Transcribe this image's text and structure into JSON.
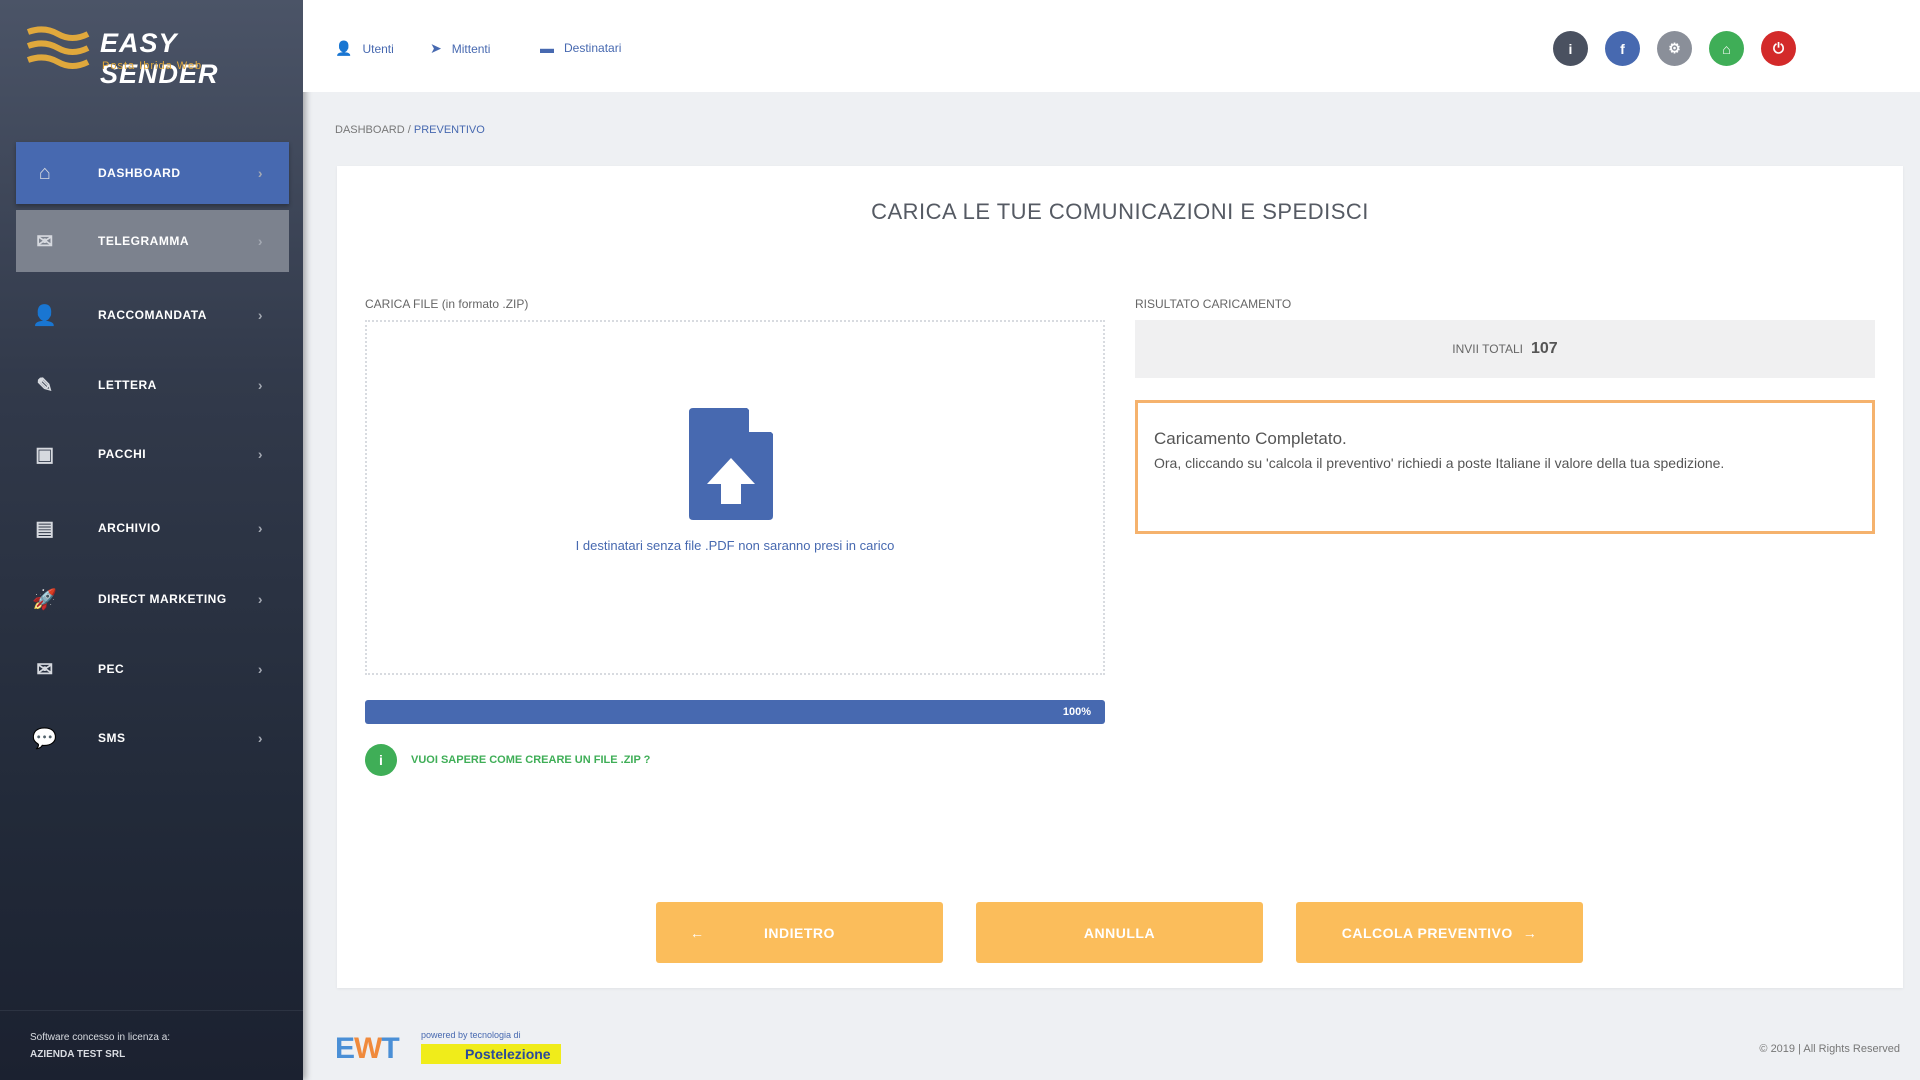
{
  "brand": {
    "name": "EASY SENDER",
    "tagline": "Posta Ibrida Web"
  },
  "sidebar": {
    "items": [
      {
        "label": "DASHBOARD",
        "icon": "home-icon",
        "state": "active"
      },
      {
        "label": "TELEGRAMMA",
        "icon": "telegram-icon",
        "state": "hover"
      },
      {
        "label": "RACCOMANDATA",
        "icon": "user-icon",
        "state": ""
      },
      {
        "label": "LETTERA",
        "icon": "letter-icon",
        "state": ""
      },
      {
        "label": "PACCHI",
        "icon": "package-icon",
        "state": ""
      },
      {
        "label": "ARCHIVIO",
        "icon": "archive-icon",
        "state": ""
      },
      {
        "label": "DIRECT MARKETING",
        "icon": "rocket-icon",
        "state": ""
      },
      {
        "label": "PEC",
        "icon": "pec-icon",
        "state": ""
      },
      {
        "label": "SMS",
        "icon": "sms-icon",
        "state": ""
      }
    ],
    "footer": {
      "line1": "Software concesso in licenza a:",
      "line2": "AZIENDA TEST SRL"
    }
  },
  "header": {
    "nav": [
      {
        "label": "Utenti",
        "icon": "user-icon"
      },
      {
        "label": "Mittenti",
        "icon": "send-icon"
      },
      {
        "label": "Destinatari",
        "icon": "address-card-icon"
      }
    ],
    "circles": [
      {
        "icon": "info-icon",
        "color": "#4a5160",
        "glyph": "i"
      },
      {
        "icon": "facebook-icon",
        "color": "#4769b0",
        "glyph": "f"
      },
      {
        "icon": "settings-icon",
        "color": "#8a8f99",
        "glyph": "⚙"
      },
      {
        "icon": "home-icon",
        "color": "#3fae57",
        "glyph": "⌂"
      },
      {
        "icon": "power-icon",
        "color": "#d32a2a",
        "glyph": "⏻"
      }
    ]
  },
  "breadcrumb": {
    "root": "DASHBOARD",
    "sep": " / ",
    "current": "PREVENTIVO"
  },
  "main": {
    "title": "CARICA LE TUE COMUNICAZIONI E SPEDISCI",
    "upload_label": "CARICA FILE (in formato .ZIP)",
    "drop_text": "I destinatari senza file .PDF non saranno presi in carico",
    "progress": 100,
    "progress_label": "100%",
    "help_text": "VUOI SAPERE COME CREARE UN FILE .ZIP ?",
    "result_label": "RISULTATO CARICAMENTO",
    "total_label": "INVII TOTALI",
    "total_value": "107",
    "alert_title": "Caricamento Completato.",
    "alert_text": "Ora, cliccando su 'calcola il preventivo' richiedi a poste Italiane il valore della tua spedizione.",
    "buttons": {
      "back": "INDIETRO",
      "back_icon": "←",
      "cancel": "ANNULLA",
      "next": "CALCOLA PREVENTIVO",
      "next_icon": "→"
    }
  },
  "footer": {
    "powered": "powered by tecnologia di",
    "partner": "Postelezione",
    "copyright": "© 2019 | All Rights Reserved"
  },
  "colors": {
    "primary": "#4769b0",
    "accent": "#fbbd5b",
    "success": "#3fae57",
    "alert_border": "#f5b26d"
  }
}
